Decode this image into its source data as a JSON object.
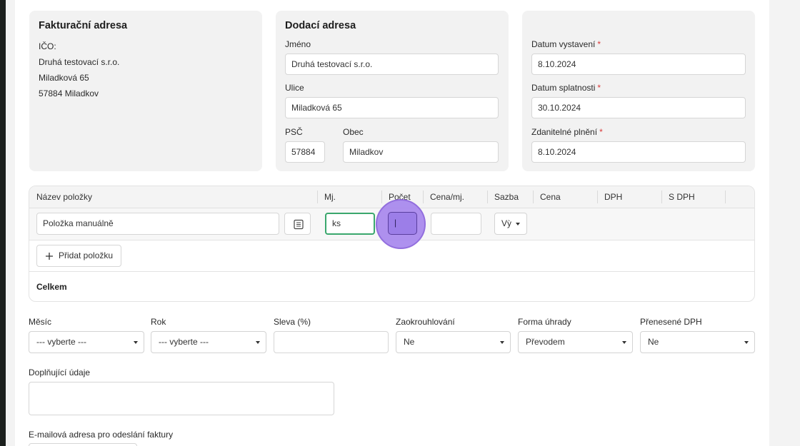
{
  "billing": {
    "title": "Fakturační adresa",
    "ico": "IČO:",
    "company": "Druhá testovací s.r.o.",
    "street": "Miladková 65",
    "city": "57884 Miladkov"
  },
  "delivery": {
    "title": "Dodací adresa",
    "name_label": "Jméno",
    "name_value": "Druhá testovací s.r.o.",
    "street_label": "Ulice",
    "street_value": "Miladková 65",
    "zip_label": "PSČ",
    "zip_value": "57884",
    "city_label": "Obec",
    "city_value": "Miladkov"
  },
  "dates": {
    "issue_label": "Datum vystavení",
    "issue_value": "8.10.2024",
    "due_label": "Datum splatnosti",
    "due_value": "30.10.2024",
    "taxable_label": "Zdanitelné plnění",
    "taxable_value": "8.10.2024",
    "required_mark": "*"
  },
  "items_table": {
    "headers": [
      "Název položky",
      "Mj.",
      "Počet",
      "Cena/mj.",
      "Sazba",
      "Cena",
      "DPH",
      "S DPH"
    ],
    "row": {
      "name": "Položka manuálně",
      "unit": "ks",
      "count": "|",
      "price": "",
      "rate": "Vỳ"
    },
    "add_button": "Přidat položku",
    "total_label": "Celkem"
  },
  "options": {
    "month_label": "Měsíc",
    "month_value": "--- vyberte ---",
    "year_label": "Rok",
    "year_value": "--- vyberte ---",
    "discount_label": "Sleva (%)",
    "discount_value": "",
    "rounding_label": "Zaokrouhlování",
    "rounding_value": "Ne",
    "payment_label": "Forma úhrady",
    "payment_value": "Převodem",
    "vat_label": "Přenesené DPH",
    "vat_value": "Ne"
  },
  "extra": {
    "notes_label": "Doplňující údaje",
    "notes_value": "",
    "email_label": "E-mailová adresa pro odeslání faktury"
  },
  "colors": {
    "focus_green": "#3aa76d",
    "cursor_purple": "#a888ee",
    "required_red": "#d93a3a"
  },
  "icons": {
    "list": "list-icon",
    "plus": "plus-icon",
    "caret": "chevron-down-icon"
  }
}
